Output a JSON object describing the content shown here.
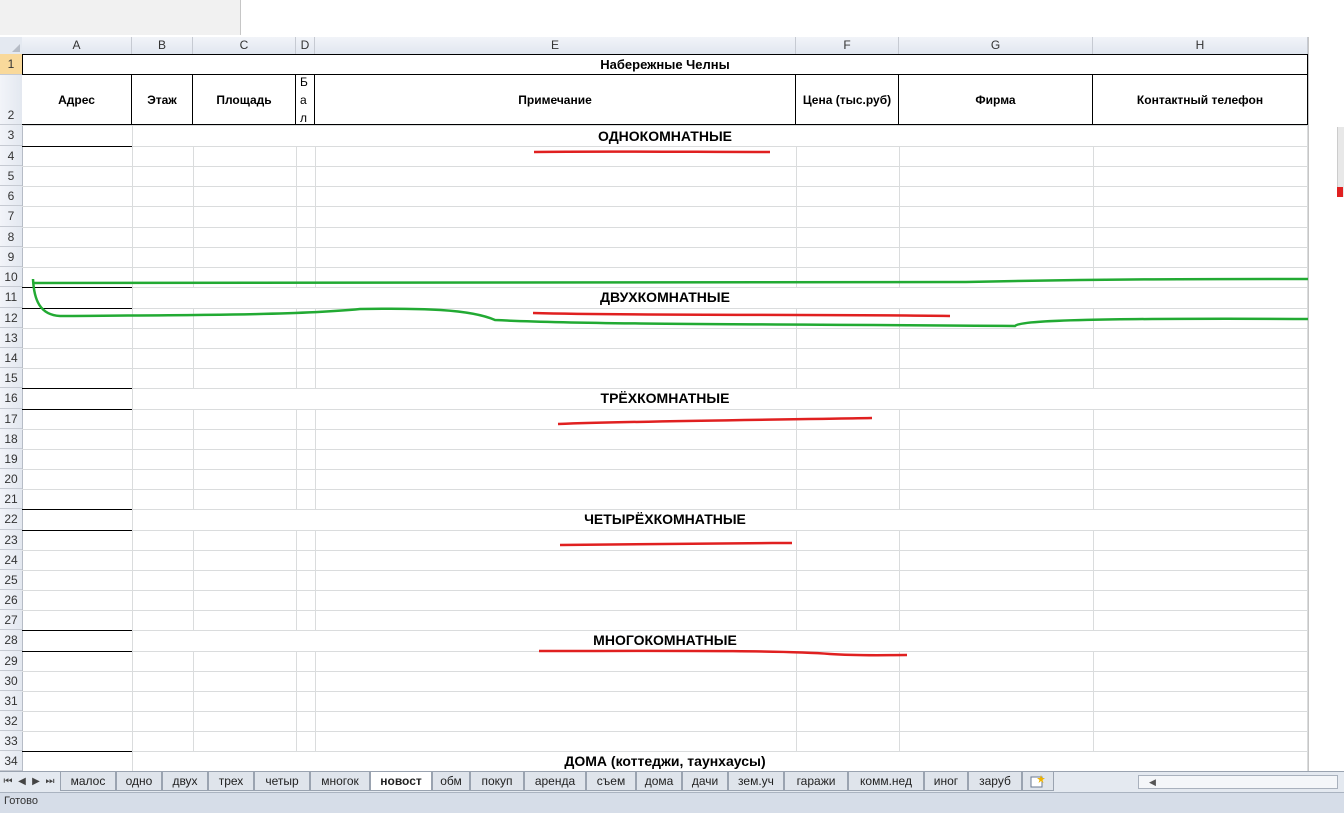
{
  "columns": [
    "A",
    "B",
    "C",
    "D",
    "E",
    "F",
    "G",
    "H"
  ],
  "rows": [
    "1",
    "2",
    "3",
    "4",
    "5",
    "6",
    "7",
    "8",
    "9",
    "10",
    "11",
    "12",
    "13",
    "14",
    "15",
    "16",
    "17",
    "18",
    "19",
    "20",
    "21",
    "22",
    "23",
    "24",
    "25",
    "26",
    "27",
    "28",
    "29",
    "30",
    "31",
    "32",
    "33",
    "34"
  ],
  "sheet": {
    "title": "Набережные Челны",
    "headers": {
      "address": "Адрес",
      "floor": "Этаж",
      "area": "Площадь",
      "points": "Бал",
      "note": "Примечание",
      "price": "Цена (тыс.руб)",
      "company": "Фирма",
      "phone": "Контактный телефон"
    },
    "sections": {
      "one_room": "ОДНОКОМНАТНЫЕ",
      "two_room": "ДВУХКОМНАТНЫЕ",
      "three_room": "ТРЁХКОМНАТНЫЕ",
      "four_room": "ЧЕТЫРЁХКОМНАТНЫЕ",
      "multi_room": "МНОГОКОМНАТНЫЕ",
      "houses": "ДОМА (коттеджи, таунхаусы)"
    }
  },
  "tabs": [
    "малос",
    "одно",
    "двух",
    "трех",
    "четыр",
    "многок",
    "новост",
    "обм",
    "покуп",
    "аренда",
    "съем",
    "дома",
    "дачи",
    "зем.уч",
    "гаражи",
    "комм.нед",
    "иног",
    "заруб"
  ],
  "active_tab": "новост",
  "status": "Готово",
  "colors": {
    "underline": "#e02020",
    "highlight": "#22aa33",
    "selected_row_header": "#f9d99b"
  }
}
